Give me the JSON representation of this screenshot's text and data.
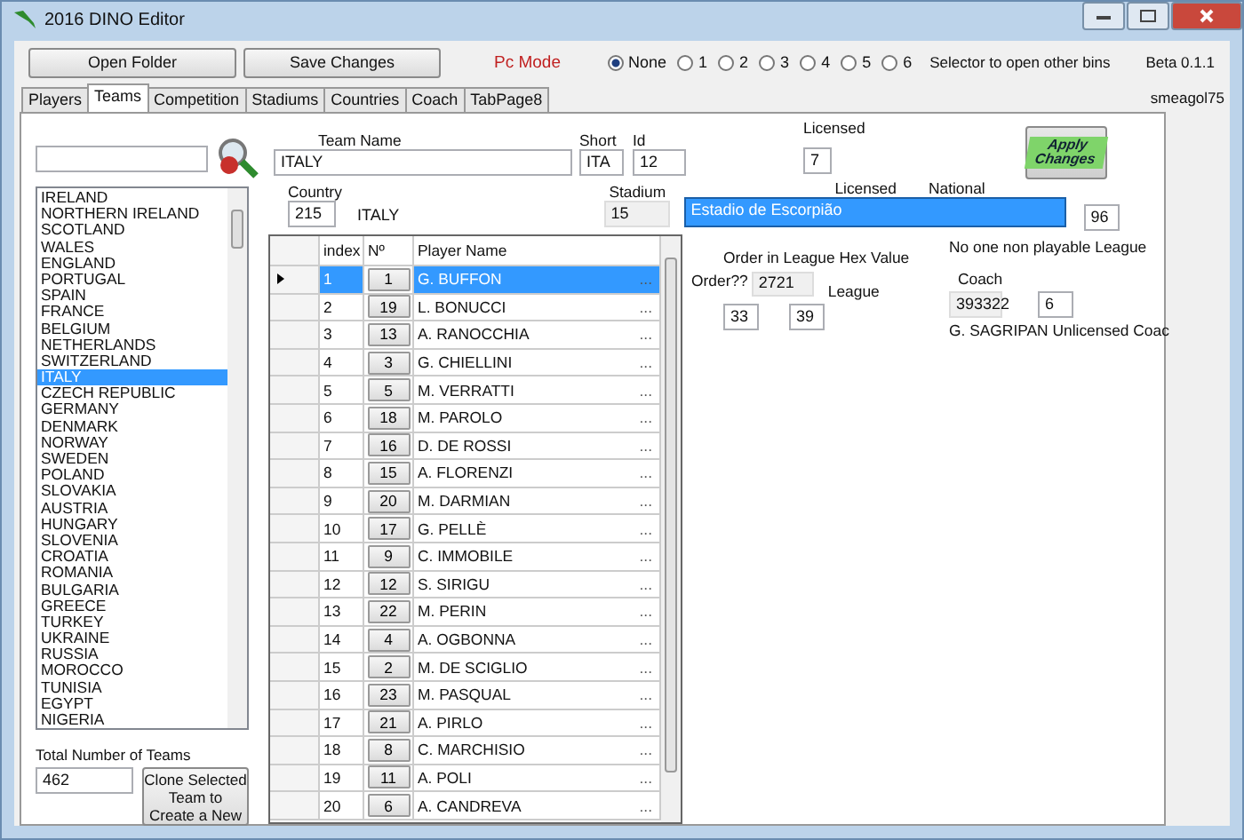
{
  "window": {
    "title": "2016 DINO Editor"
  },
  "toolbar": {
    "buttons": [
      "Open Folder",
      "Save Changes"
    ],
    "mode_label": "Pc Mode",
    "bins": [
      {
        "label": "None",
        "selected": true
      },
      {
        "label": "1",
        "selected": false
      },
      {
        "label": "2",
        "selected": false
      },
      {
        "label": "3",
        "selected": false
      },
      {
        "label": "4",
        "selected": false
      },
      {
        "label": "5",
        "selected": false
      },
      {
        "label": "6",
        "selected": false
      }
    ],
    "bins_hint": "Selector to open other bins",
    "version": "Beta 0.1.1",
    "author": "smeagol75"
  },
  "tabs": [
    {
      "label": "Players",
      "selected": false
    },
    {
      "label": "Teams",
      "selected": true
    },
    {
      "label": "Competition",
      "selected": false
    },
    {
      "label": "Stadiums",
      "selected": false
    },
    {
      "label": "Countries",
      "selected": false
    },
    {
      "label": "Coach",
      "selected": false
    },
    {
      "label": "TabPage8",
      "selected": false
    }
  ],
  "teams": {
    "items": [
      {
        "name": "IRELAND",
        "selected": false
      },
      {
        "name": "NORTHERN IRELAND",
        "selected": false
      },
      {
        "name": "SCOTLAND",
        "selected": false
      },
      {
        "name": "WALES",
        "selected": false
      },
      {
        "name": "ENGLAND",
        "selected": false
      },
      {
        "name": "PORTUGAL",
        "selected": false
      },
      {
        "name": "SPAIN",
        "selected": false
      },
      {
        "name": "FRANCE",
        "selected": false
      },
      {
        "name": "BELGIUM",
        "selected": false
      },
      {
        "name": "NETHERLANDS",
        "selected": false
      },
      {
        "name": "SWITZERLAND",
        "selected": false
      },
      {
        "name": "ITALY",
        "selected": true
      },
      {
        "name": "CZECH REPUBLIC",
        "selected": false
      },
      {
        "name": "GERMANY",
        "selected": false
      },
      {
        "name": "DENMARK",
        "selected": false
      },
      {
        "name": "NORWAY",
        "selected": false
      },
      {
        "name": "SWEDEN",
        "selected": false
      },
      {
        "name": "POLAND",
        "selected": false
      },
      {
        "name": "SLOVAKIA",
        "selected": false
      },
      {
        "name": "AUSTRIA",
        "selected": false
      },
      {
        "name": "HUNGARY",
        "selected": false
      },
      {
        "name": "SLOVENIA",
        "selected": false
      },
      {
        "name": "CROATIA",
        "selected": false
      },
      {
        "name": "ROMANIA",
        "selected": false
      },
      {
        "name": "BULGARIA",
        "selected": false
      },
      {
        "name": "GREECE",
        "selected": false
      },
      {
        "name": "TURKEY",
        "selected": false
      },
      {
        "name": "UKRAINE",
        "selected": false
      },
      {
        "name": "RUSSIA",
        "selected": false
      },
      {
        "name": "MOROCCO",
        "selected": false
      },
      {
        "name": "TUNISIA",
        "selected": false
      },
      {
        "name": "EGYPT",
        "selected": false
      },
      {
        "name": "NIGERIA",
        "selected": false
      }
    ],
    "total_label": "Total  Number of Teams",
    "total": "462",
    "clone_button": "Clone Selected Team to Create a New"
  },
  "team": {
    "name_label": "Team Name",
    "name": "ITALY",
    "short_label": "Short",
    "short": "ITA",
    "id_label": "Id",
    "id": "12",
    "licensed_label": "Licensed",
    "licensed": "7",
    "apply_button": "Apply Changes",
    "country_label": "Country",
    "country_id": "215",
    "country": "ITALY",
    "stadium_label": "Stadium",
    "stadium_id": "15",
    "licensed_label_2": "Licensed",
    "national_label": "National",
    "stadium_name": "Estadio de Escorpião",
    "stadium_value": "96"
  },
  "players": {
    "columns": [
      "index",
      "Nº",
      "Player Name"
    ],
    "rows": [
      {
        "index": "1",
        "number": "1",
        "name": "G. BUFFON",
        "selected": true
      },
      {
        "index": "2",
        "number": "19",
        "name": "L. BONUCCI",
        "selected": false
      },
      {
        "index": "3",
        "number": "13",
        "name": "A. RANOCCHIA",
        "selected": false
      },
      {
        "index": "4",
        "number": "3",
        "name": "G. CHIELLINI",
        "selected": false
      },
      {
        "index": "5",
        "number": "5",
        "name": "M. VERRATTI",
        "selected": false
      },
      {
        "index": "6",
        "number": "18",
        "name": "M. PAROLO",
        "selected": false
      },
      {
        "index": "7",
        "number": "16",
        "name": "D. DE ROSSI",
        "selected": false
      },
      {
        "index": "8",
        "number": "15",
        "name": "A. FLORENZI",
        "selected": false
      },
      {
        "index": "9",
        "number": "20",
        "name": "M. DARMIAN",
        "selected": false
      },
      {
        "index": "10",
        "number": "17",
        "name": "G. PELLÈ",
        "selected": false
      },
      {
        "index": "11",
        "number": "9",
        "name": "C. IMMOBILE",
        "selected": false
      },
      {
        "index": "12",
        "number": "12",
        "name": "S. SIRIGU",
        "selected": false
      },
      {
        "index": "13",
        "number": "22",
        "name": "M. PERIN",
        "selected": false
      },
      {
        "index": "14",
        "number": "4",
        "name": "A. OGBONNA",
        "selected": false
      },
      {
        "index": "15",
        "number": "2",
        "name": "M. DE SCIGLIO",
        "selected": false
      },
      {
        "index": "16",
        "number": "23",
        "name": "M. PASQUAL",
        "selected": false
      },
      {
        "index": "17",
        "number": "21",
        "name": "A. PIRLO",
        "selected": false
      },
      {
        "index": "18",
        "number": "8",
        "name": "C. MARCHISIO",
        "selected": false
      },
      {
        "index": "19",
        "number": "11",
        "name": "A. POLI",
        "selected": false
      },
      {
        "index": "20",
        "number": "6",
        "name": "A. CANDREVA",
        "selected": false
      }
    ],
    "more": "..."
  },
  "league": {
    "title": "Order in League Hex Value",
    "order_label": "Order??",
    "order_hex": "2721",
    "league_label": "League",
    "order": "33",
    "league": "39"
  },
  "coach": {
    "note": "No one non playable League",
    "label": "Coach",
    "id": "393322",
    "value": "6",
    "name": "G. SAGRIPAN Unlicensed Coac"
  }
}
